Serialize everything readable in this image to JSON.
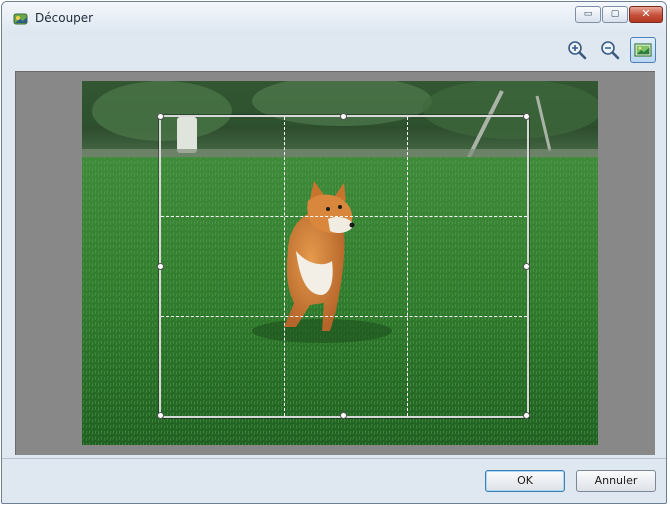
{
  "window": {
    "title": "Découper",
    "app_icon": "crop-app-icon",
    "controls": [
      {
        "name": "minimize-button",
        "icon": "minimize-icon",
        "glyph": "▭"
      },
      {
        "name": "maximize-button",
        "icon": "maximize-icon",
        "glyph": "▢"
      },
      {
        "name": "close-button",
        "icon": "close-icon",
        "glyph": "✕"
      }
    ]
  },
  "toolbar": {
    "buttons": [
      {
        "name": "zoom-in-button",
        "icon": "zoom-in-icon"
      },
      {
        "name": "zoom-out-button",
        "icon": "zoom-out-icon"
      },
      {
        "name": "fit-to-window-button",
        "icon": "image-fit-icon",
        "state": "active"
      }
    ]
  },
  "preview": {
    "image": "dog-running-on-grass-photo",
    "crop_frame": {
      "grid": "3x3 dashed",
      "handles": 8
    }
  },
  "buttons": {
    "ok": "OK",
    "cancel": "Annuler"
  },
  "colors": {
    "window_bg": "#dfe7f1",
    "canvas_bg": "#888888",
    "active_toggle": "#b9d6f1"
  }
}
